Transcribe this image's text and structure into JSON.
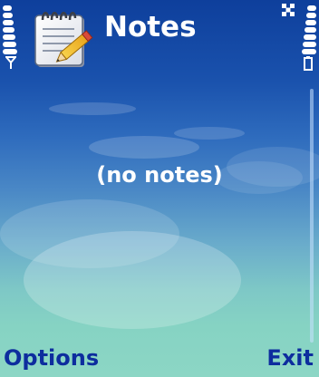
{
  "status_bar": {
    "signal_level": 7,
    "battery_level": 7
  },
  "header": {
    "title": "Notes",
    "app_icon": "notepad-pencil-icon"
  },
  "content": {
    "empty_message": "(no notes)"
  },
  "softkeys": {
    "left_label": "Options",
    "right_label": "Exit"
  },
  "colors": {
    "softkey_text": "#0d2d9e",
    "title_text": "#ffffff",
    "background_top": "#0e3f9c",
    "background_bottom": "#8cd6c5"
  }
}
